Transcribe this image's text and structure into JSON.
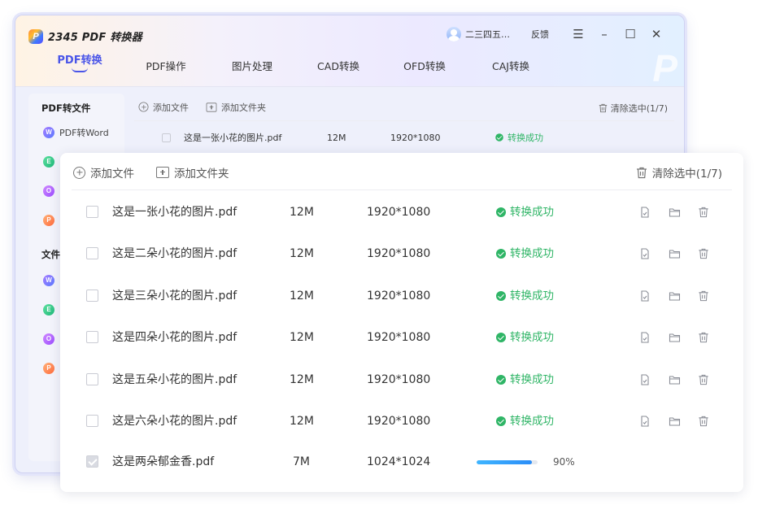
{
  "app": {
    "logo_letter": "P",
    "title": "2345 PDF 转换器",
    "user_name": "二三四五…",
    "feedback": "反馈",
    "window_controls": [
      "menu-icon",
      "minimize-icon",
      "maximize-icon",
      "close-icon"
    ],
    "tabs": [
      {
        "label": "PDF转换",
        "active": true
      },
      {
        "label": "PDF操作",
        "active": false
      },
      {
        "label": "图片处理",
        "active": false
      },
      {
        "label": "CAD转换",
        "active": false
      },
      {
        "label": "OFD转换",
        "active": false
      },
      {
        "label": "CAJ转换",
        "active": false
      }
    ],
    "watermark": "P"
  },
  "sidebar": {
    "section1_title": "PDF转文件",
    "section1_items": [
      {
        "label": "PDF转Word",
        "icon": "W"
      },
      {
        "label": "",
        "icon": "E"
      },
      {
        "label": "",
        "icon": "O"
      },
      {
        "label": "",
        "icon": "P"
      }
    ],
    "section2_title": "文件",
    "section2_items": [
      {
        "label": "",
        "icon": "W"
      },
      {
        "label": "",
        "icon": "E"
      },
      {
        "label": "",
        "icon": "O"
      },
      {
        "label": "",
        "icon": "P"
      }
    ]
  },
  "bg_list": {
    "add_file": "添加文件",
    "add_folder": "添加文件夹",
    "clear": "清除选中(1/7)",
    "first_row": {
      "name": "这是一张小花的图片.pdf",
      "size": "12M",
      "resolution": "1920*1080",
      "status": "转换成功"
    }
  },
  "toolbar": {
    "add_file": "添加文件",
    "add_folder": "添加文件夹",
    "clear": "清除选中(1/7)"
  },
  "files": [
    {
      "name": "这是一张小花的图片.pdf",
      "size": "12M",
      "resolution": "1920*1080",
      "status": "转换成功",
      "checked": false
    },
    {
      "name": "这是二朵小花的图片.pdf",
      "size": "12M",
      "resolution": "1920*1080",
      "status": "转换成功",
      "checked": false
    },
    {
      "name": "这是三朵小花的图片.pdf",
      "size": "12M",
      "resolution": "1920*1080",
      "status": "转换成功",
      "checked": false
    },
    {
      "name": "这是四朵小花的图片.pdf",
      "size": "12M",
      "resolution": "1920*1080",
      "status": "转换成功",
      "checked": false
    },
    {
      "name": "这是五朵小花的图片.pdf",
      "size": "12M",
      "resolution": "1920*1080",
      "status": "转换成功",
      "checked": false
    },
    {
      "name": "这是六朵小花的图片.pdf",
      "size": "12M",
      "resolution": "1920*1080",
      "status": "转换成功",
      "checked": false
    }
  ],
  "converting": {
    "name": "这是两朵郁金香.pdf",
    "size": "7M",
    "resolution": "1024*1024",
    "progress": 0.9,
    "progress_text": "90%",
    "checked": true
  },
  "colors": {
    "accent": "#4a55e8",
    "success": "#2fb566",
    "progress": "#2b8df7"
  }
}
